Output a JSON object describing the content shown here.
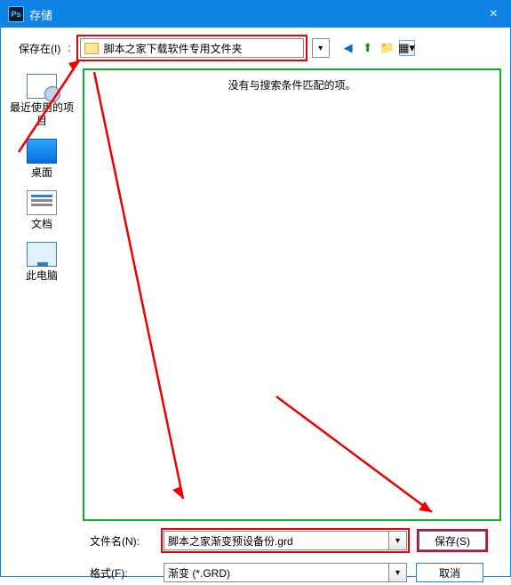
{
  "titlebar": {
    "title": "存储"
  },
  "toprow": {
    "save_in_label": "保存在(I)",
    "location": "脚本之家下载软件专用文件夹"
  },
  "sidebar": {
    "items": [
      {
        "label": "最近使用的项目"
      },
      {
        "label": "桌面"
      },
      {
        "label": "文档"
      },
      {
        "label": "此电脑"
      }
    ]
  },
  "filearea": {
    "empty_message": "没有与搜索条件匹配的项。"
  },
  "bottom": {
    "filename_label": "文件名(N):",
    "filename_value": "脚本之家渐变预设备份.grd",
    "format_label": "格式(F):",
    "format_value": "渐变 (*.GRD)",
    "save_label": "保存(S)",
    "cancel_label": "取消"
  }
}
